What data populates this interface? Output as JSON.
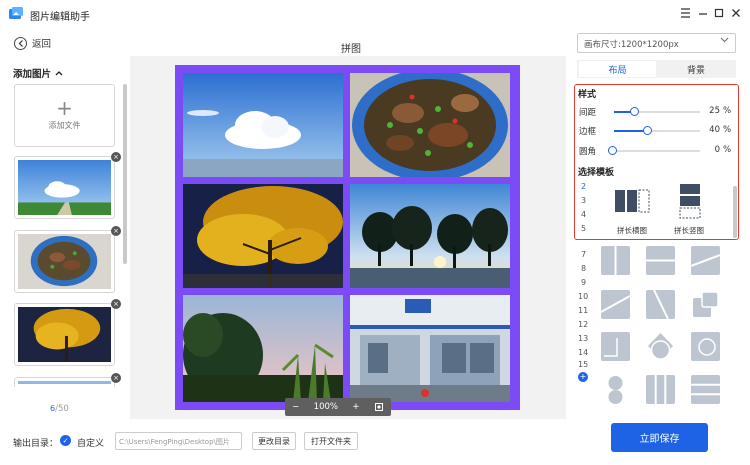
{
  "app": {
    "title": "图片编辑助手"
  },
  "header": {
    "back_label": "返回",
    "page_title": "拼图"
  },
  "left": {
    "section_title": "添加图片",
    "add_file_label": "添加文件",
    "count_current": "6",
    "count_total": "/50"
  },
  "zoom": {
    "minus": "−",
    "value": "100%",
    "plus": "+"
  },
  "bottom": {
    "output_label": "输出目录：",
    "custom_label": "自定义",
    "path_value": "C:\\Users\\FengPing\\Desktop\\图片",
    "change_dir_label": "更改目录",
    "open_folder_label": "打开文件夹",
    "save_label": "立即保存"
  },
  "right": {
    "canvas_size": "画布尺寸:1200*1200px",
    "tabs": [
      {
        "label": "布局"
      },
      {
        "label": "背景"
      }
    ],
    "style_title": "样式",
    "sliders": [
      {
        "label": "间距",
        "value": "25",
        "unit": "%",
        "fraction": 0.25
      },
      {
        "label": "边框",
        "value": "40",
        "unit": "%",
        "fraction": 0.4
      },
      {
        "label": "圆角",
        "value": "0",
        "unit": "%",
        "fraction": 0.0
      }
    ],
    "template_title": "选择模板",
    "numbers_in_box": [
      "2",
      "3",
      "4",
      "5"
    ],
    "numbers_outside": [
      "7",
      "8",
      "9",
      "10",
      "11",
      "12",
      "13",
      "14",
      "15"
    ],
    "templates": [
      {
        "label": "拼长横图"
      },
      {
        "label": "拼长竖图"
      }
    ]
  },
  "colors": {
    "accent": "#1e63e6",
    "collage_border": "#7b4cf5",
    "highlight_box": "#e23b2e"
  }
}
